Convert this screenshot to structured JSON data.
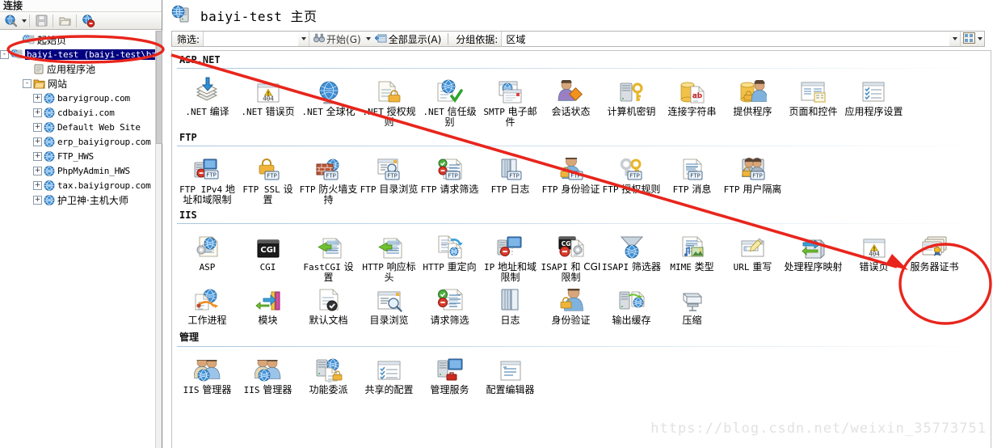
{
  "sidebar": {
    "title": "连接",
    "toolbar": [
      {
        "name": "connect-icon",
        "label": ""
      },
      {
        "name": "save-icon",
        "label": ""
      },
      {
        "name": "open-folder-icon",
        "label": ""
      },
      {
        "name": "disconnect-icon",
        "label": ""
      }
    ],
    "tree": [
      {
        "label": "起始页",
        "icon": "start-page-icon",
        "indent": 1,
        "expander": "",
        "selected": false,
        "cjk": true
      },
      {
        "label": "baiyi-test (baiyi-test\\bai",
        "icon": "server-icon",
        "indent": 1,
        "expander": "-",
        "selected": true,
        "cjk": false
      },
      {
        "label": "应用程序池",
        "icon": "app-pool-icon",
        "indent": 2,
        "expander": "",
        "selected": false,
        "cjk": true
      },
      {
        "label": "网站",
        "icon": "sites-folder-icon",
        "indent": 2,
        "expander": "-",
        "selected": false,
        "cjk": true
      },
      {
        "label": "baryigroup.com",
        "icon": "site-icon",
        "indent": 3,
        "expander": "+",
        "selected": false,
        "cjk": false
      },
      {
        "label": "cdbaiyi.com",
        "icon": "site-icon",
        "indent": 3,
        "expander": "+",
        "selected": false,
        "cjk": false
      },
      {
        "label": "Default Web Site",
        "icon": "site-icon",
        "indent": 3,
        "expander": "+",
        "selected": false,
        "cjk": false
      },
      {
        "label": "erp_baiyigroup.com",
        "icon": "site-icon",
        "indent": 3,
        "expander": "+",
        "selected": false,
        "cjk": false
      },
      {
        "label": "FTP_HWS",
        "icon": "site-icon",
        "indent": 3,
        "expander": "+",
        "selected": false,
        "cjk": false
      },
      {
        "label": "PhpMyAdmin_HWS",
        "icon": "site-icon",
        "indent": 3,
        "expander": "+",
        "selected": false,
        "cjk": false
      },
      {
        "label": "tax.baiyigroup.com",
        "icon": "site-icon",
        "indent": 3,
        "expander": "+",
        "selected": false,
        "cjk": false
      },
      {
        "label": "护卫神·主机大师",
        "icon": "site-icon",
        "indent": 3,
        "expander": "+",
        "selected": false,
        "cjk": true
      }
    ]
  },
  "header": {
    "title_mono": "baiyi-test",
    "title_cjk": "主页",
    "icon": "server-home-icon"
  },
  "filter": {
    "label": "筛选:",
    "value": "",
    "placeholder": "",
    "go_label": "开始(G)",
    "show_all_label": "全部显示(A)",
    "group_by_label": "分组依据:",
    "group_by_value": "区域",
    "view_icon": "view-mode-icon"
  },
  "sections": [
    {
      "name": "ASP.NET",
      "mono_title": true,
      "items": [
        {
          "label": ".NET 编译",
          "icon": "net-compilation-icon"
        },
        {
          "label": ".NET 错误页",
          "icon": "net-error-pages-icon"
        },
        {
          "label": ".NET 全球化",
          "icon": "net-globalization-icon"
        },
        {
          "label": ".NET 授权规则",
          "icon": "net-authorization-rules-icon"
        },
        {
          "label": ".NET 信任级别",
          "icon": "net-trust-levels-icon"
        },
        {
          "label": "SMTP 电子邮件",
          "icon": "smtp-email-icon"
        },
        {
          "label": "会话状态",
          "icon": "session-state-icon"
        },
        {
          "label": "计算机密钥",
          "icon": "machine-key-icon"
        },
        {
          "label": "连接字符串",
          "icon": "connection-strings-icon"
        },
        {
          "label": "提供程序",
          "icon": "providers-icon"
        },
        {
          "label": "页面和控件",
          "icon": "pages-and-controls-icon"
        },
        {
          "label": "应用程序设置",
          "icon": "application-settings-icon"
        }
      ]
    },
    {
      "name": "FTP",
      "mono_title": true,
      "items": [
        {
          "label": "FTP IPv4 地址和域限制",
          "icon": "ftp-ipv4-restrictions-icon"
        },
        {
          "label": "FTP SSL 设置",
          "icon": "ftp-ssl-settings-icon"
        },
        {
          "label": "FTP 防火墙支持",
          "icon": "ftp-firewall-support-icon"
        },
        {
          "label": "FTP 目录浏览",
          "icon": "ftp-directory-browsing-icon"
        },
        {
          "label": "FTP 请求筛选",
          "icon": "ftp-request-filtering-icon"
        },
        {
          "label": "FTP 日志",
          "icon": "ftp-logging-icon"
        },
        {
          "label": "FTP 身份验证",
          "icon": "ftp-authentication-icon"
        },
        {
          "label": "FTP 授权规则",
          "icon": "ftp-authorization-rules-icon"
        },
        {
          "label": "FTP 消息",
          "icon": "ftp-messages-icon"
        },
        {
          "label": "FTP 用户隔离",
          "icon": "ftp-user-isolation-icon"
        }
      ]
    },
    {
      "name": "IIS",
      "mono_title": true,
      "items": [
        {
          "label": "ASP",
          "icon": "asp-icon"
        },
        {
          "label": "CGI",
          "icon": "cgi-icon"
        },
        {
          "label": "FastCGI 设置",
          "icon": "fastcgi-settings-icon"
        },
        {
          "label": "HTTP 响应标头",
          "icon": "http-response-headers-icon"
        },
        {
          "label": "HTTP 重定向",
          "icon": "http-redirect-icon"
        },
        {
          "label": "IP 地址和域限制",
          "icon": "ip-address-domain-restrictions-icon"
        },
        {
          "label": "ISAPI 和 CGI 限制",
          "icon": "isapi-cgi-restrictions-icon"
        },
        {
          "label": "ISAPI 筛选器",
          "icon": "isapi-filters-icon"
        },
        {
          "label": "MIME 类型",
          "icon": "mime-types-icon"
        },
        {
          "label": "URL 重写",
          "icon": "url-rewrite-icon"
        },
        {
          "label": "处理程序映射",
          "icon": "handler-mappings-icon"
        },
        {
          "label": "错误页",
          "icon": "error-pages-icon"
        },
        {
          "label": "服务器证书",
          "icon": "server-certificates-icon",
          "highlighted": true
        },
        {
          "label": "工作进程",
          "icon": "worker-processes-icon"
        },
        {
          "label": "模块",
          "icon": "modules-icon"
        },
        {
          "label": "默认文档",
          "icon": "default-document-icon"
        },
        {
          "label": "目录浏览",
          "icon": "directory-browsing-icon"
        },
        {
          "label": "请求筛选",
          "icon": "request-filtering-icon"
        },
        {
          "label": "日志",
          "icon": "logging-icon"
        },
        {
          "label": "身份验证",
          "icon": "authentication-icon"
        },
        {
          "label": "输出缓存",
          "icon": "output-caching-icon"
        },
        {
          "label": "压缩",
          "icon": "compression-icon"
        }
      ]
    },
    {
      "name": "管理",
      "mono_title": false,
      "items": [
        {
          "label": "IIS 管理器",
          "icon": "iis-manager-users-icon"
        },
        {
          "label": "IIS 管理器",
          "icon": "iis-manager-permissions-icon"
        },
        {
          "label": "功能委派",
          "icon": "feature-delegation-icon"
        },
        {
          "label": "共享的配置",
          "icon": "shared-configuration-icon"
        },
        {
          "label": "管理服务",
          "icon": "management-service-icon"
        },
        {
          "label": "配置编辑器",
          "icon": "configuration-editor-icon"
        }
      ]
    }
  ],
  "annotations": {
    "circle_tree_label": "",
    "circle_cert_label": "",
    "arrow_label": "",
    "color": "#e8251c"
  },
  "watermark": "https://blog.csdn.net/weixin_35773751"
}
